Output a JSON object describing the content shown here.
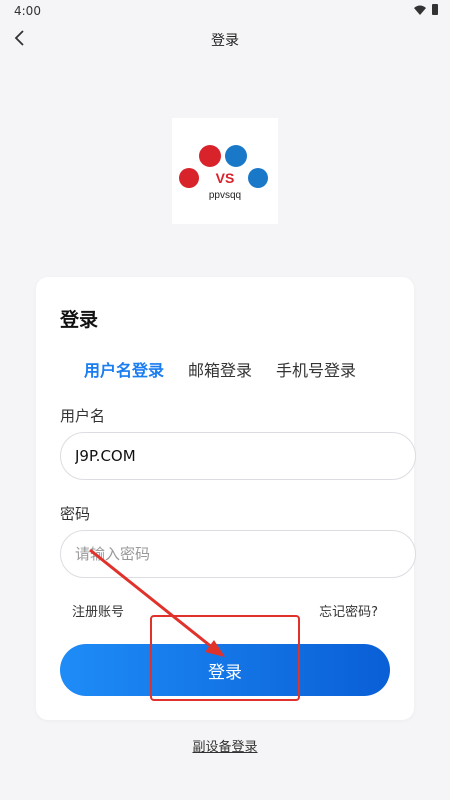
{
  "status_bar": {
    "time": "4:00",
    "wifi_icon": "wifi-icon",
    "battery_icon": "battery-icon"
  },
  "header": {
    "back_icon": "chevron-left-icon",
    "title": "登录"
  },
  "logo": {
    "text_vs": "VS",
    "text_brand": "ppvsqq"
  },
  "card": {
    "title": "登录",
    "tabs": [
      {
        "label": "用户名登录",
        "active": true
      },
      {
        "label": "邮箱登录",
        "active": false
      },
      {
        "label": "手机号登录",
        "active": false
      }
    ],
    "username": {
      "label": "用户名",
      "value": "J9P.COM",
      "placeholder": ""
    },
    "password": {
      "label": "密码",
      "value": "",
      "placeholder": "请输入密码"
    },
    "register_label": "注册账号",
    "forgot_label": "忘记密码?",
    "login_label": "登录"
  },
  "secondary_login": "副设备登录",
  "colors": {
    "accent": "#1a7df0",
    "button_start": "#1e8cf7",
    "button_end": "#0a5fd6",
    "annotation": "#e0322b"
  }
}
